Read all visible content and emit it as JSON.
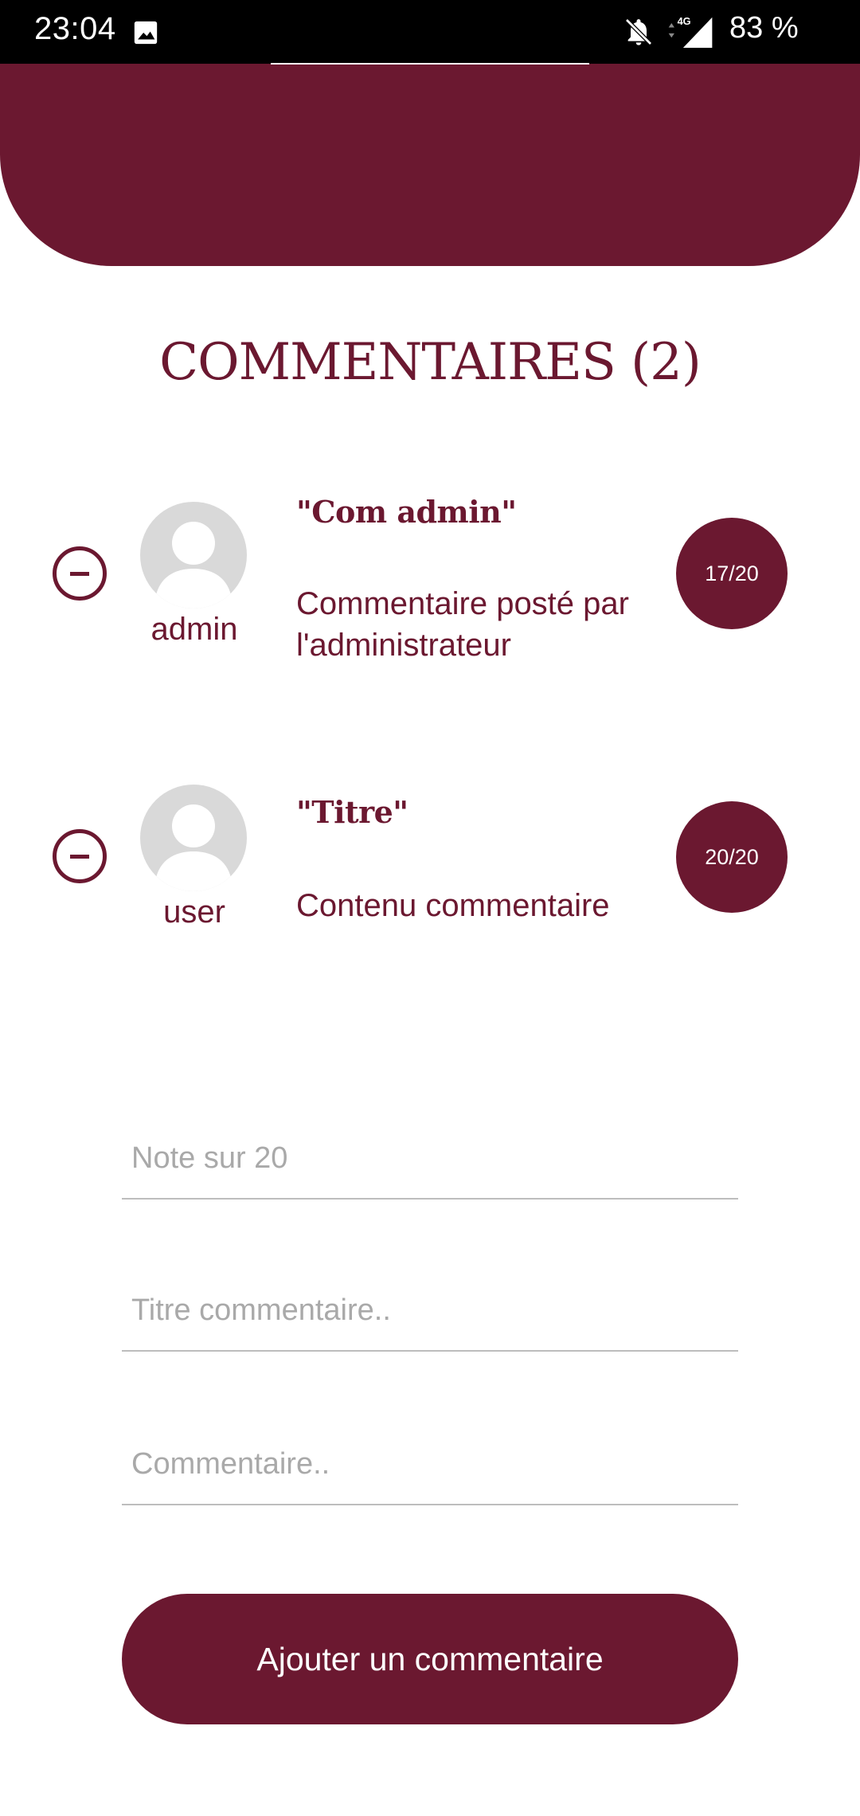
{
  "status_bar": {
    "time": "23:04",
    "battery": "83 %",
    "gallery_icon": "image-icon",
    "mute_icon": "bell-off-icon",
    "signal_icon": "signal-4g-icon"
  },
  "colors": {
    "accent": "#6b1830",
    "placeholder": "#a9a9a9",
    "avatar_bg": "#d9d9d9"
  },
  "section": {
    "title": "COMMENTAIRES (2)"
  },
  "comments": [
    {
      "author": "admin",
      "title": "\"Com admin\"",
      "body": "Commentaire posté par l'administrateur",
      "grade": "17/20",
      "remove_icon": "minus-circle-icon",
      "avatar_icon": "user-avatar-icon"
    },
    {
      "author": "user",
      "title": "\"Titre\"",
      "body": "Contenu commentaire",
      "grade": "20/20",
      "remove_icon": "minus-circle-icon",
      "avatar_icon": "user-avatar-icon"
    }
  ],
  "form": {
    "grade_placeholder": "Note sur 20",
    "title_placeholder": "Titre commentaire..",
    "comment_placeholder": "Commentaire..",
    "submit_label": "Ajouter un commentaire"
  }
}
